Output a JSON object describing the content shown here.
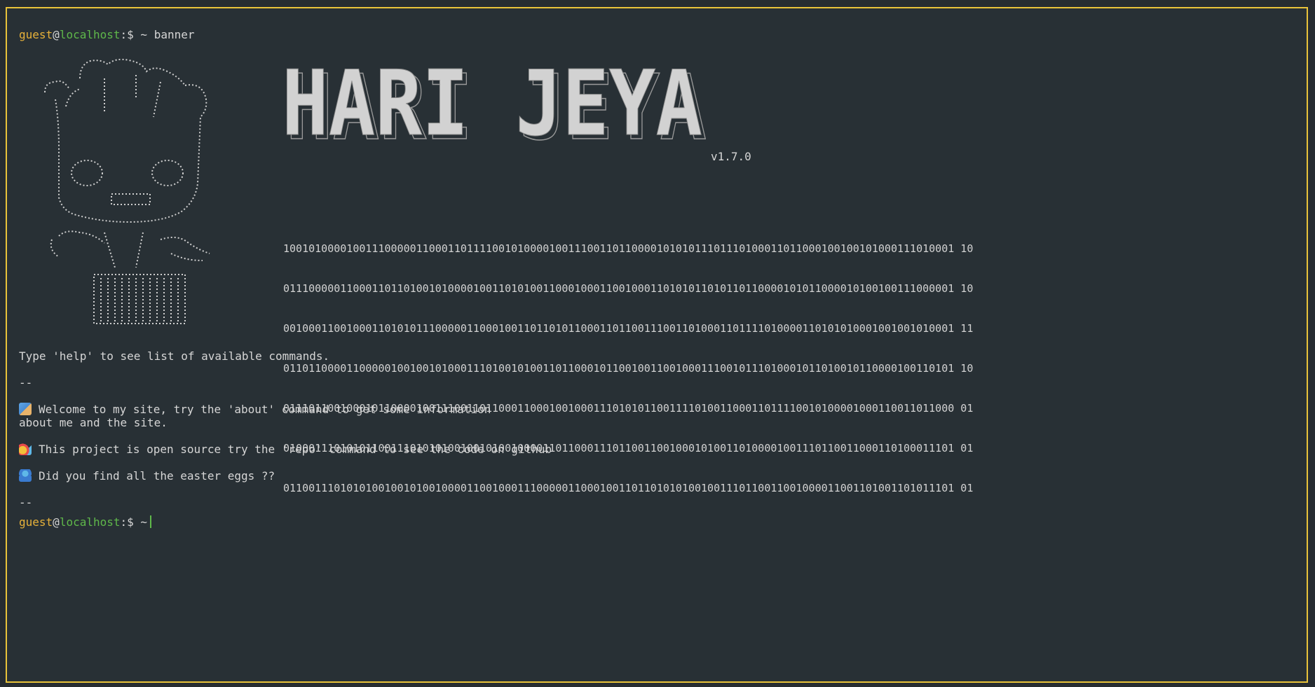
{
  "prompt": {
    "user": "guest",
    "at": "@",
    "host": "localhost",
    "path": ":$ ~"
  },
  "first_command": "banner",
  "logo_text": "HARI JEYA",
  "version": "v1.7.0",
  "binary_lines": [
    "1001010000100111000001100011011110010100001001110011011000010101011101110100011011000100100101000111010001 10",
    "0111000001100011011010010100001001101010011000100011001000110101011010110110000101011000010100100111000001 10",
    "0010001100100011010101110000011000100110110101100011011001110011010001101111010000110101010001001001010001 11",
    "0110110000110000010010010100011101001010011011000101100100110010001110010111010001011010010110000100110101 10",
    "0111011001000101100001001110011011000110001001000111010101100111101001100011011110010100001000110011011000 01",
    "0100011101010110011101010100100101001000011011000111011001100100010100110100001001110110011000110100011101 01",
    "0110011101010100100101001000011001000111000001100010011011010101001001110110011001000011001101001101011101 01"
  ],
  "help_text": "Type 'help' to see list of available commands.",
  "separator": "--",
  "welcome": {
    "icon": "technologist-emoji",
    "line1": "Welcome to my site, try the 'about' command to get some information",
    "line2": "about me and the site."
  },
  "open_source": {
    "icon": "party-popper-emoji",
    "text": "This project is open source try the 'repo' command to see the code on github"
  },
  "easter_eggs": {
    "icon": "genie-emoji",
    "text": "Did you find all the easter eggs ??"
  },
  "colors": {
    "background": "#283035",
    "border": "#e9c33a",
    "user": "#e6b13a",
    "host": "#5fb84a",
    "text": "#d6d6d6"
  }
}
